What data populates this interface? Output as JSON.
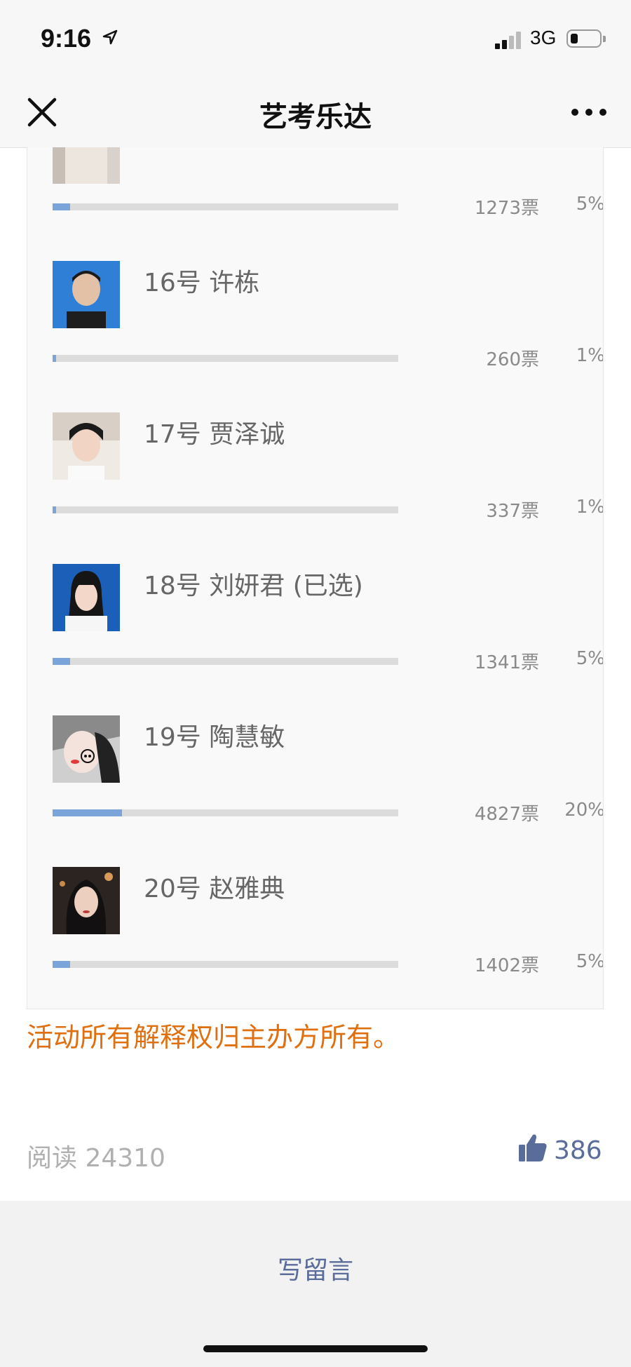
{
  "status_bar": {
    "time": "9:16",
    "network": "3G"
  },
  "nav": {
    "title": "艺考乐达",
    "close_icon": "close-icon",
    "more_icon": "more-dots-icon"
  },
  "colors": {
    "bar_fill": "#7ba5d9",
    "bar_track": "#dcdcdc",
    "notice": "#e06f10",
    "link": "#596c9a"
  },
  "candidates": [
    {
      "name": "",
      "votes": "1273票",
      "percent": "5%",
      "fraction": 0.05
    },
    {
      "name": "16号 许栋",
      "votes": "260票",
      "percent": "1%",
      "fraction": 0.01
    },
    {
      "name": "17号 贾泽诚",
      "votes": "337票",
      "percent": "1%",
      "fraction": 0.01
    },
    {
      "name": "18号 刘妍君 (已选)",
      "votes": "1341票",
      "percent": "5%",
      "fraction": 0.05
    },
    {
      "name": "19号 陶慧敏",
      "votes": "4827票",
      "percent": "20%",
      "fraction": 0.2
    },
    {
      "name": "20号 赵雅典",
      "votes": "1402票",
      "percent": "5%",
      "fraction": 0.05
    }
  ],
  "footer": {
    "notice": "活动所有解释权归主办方所有。",
    "reads": "阅读 24310",
    "likes": "386",
    "write_comment": "写留言"
  }
}
